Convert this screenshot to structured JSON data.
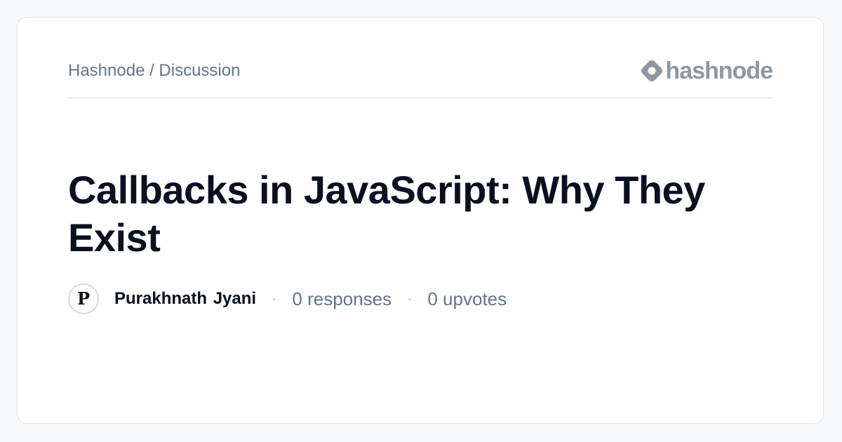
{
  "header": {
    "breadcrumb": "Hashnode / Discussion",
    "logo_text": "hashnode",
    "logo_icon": "hashnode-logo-icon"
  },
  "post": {
    "title": "Callbacks in JavaScript: Why They Exist",
    "author": {
      "initial": "P",
      "name": "Purakhnath Jyani"
    },
    "separator": "·",
    "responses": "0 responses",
    "upvotes": "0 upvotes"
  },
  "colors": {
    "background": "#f8f9fb",
    "card": "#ffffff",
    "title": "#0b1020",
    "muted": "#64748b",
    "logo": "#8e97a4"
  }
}
